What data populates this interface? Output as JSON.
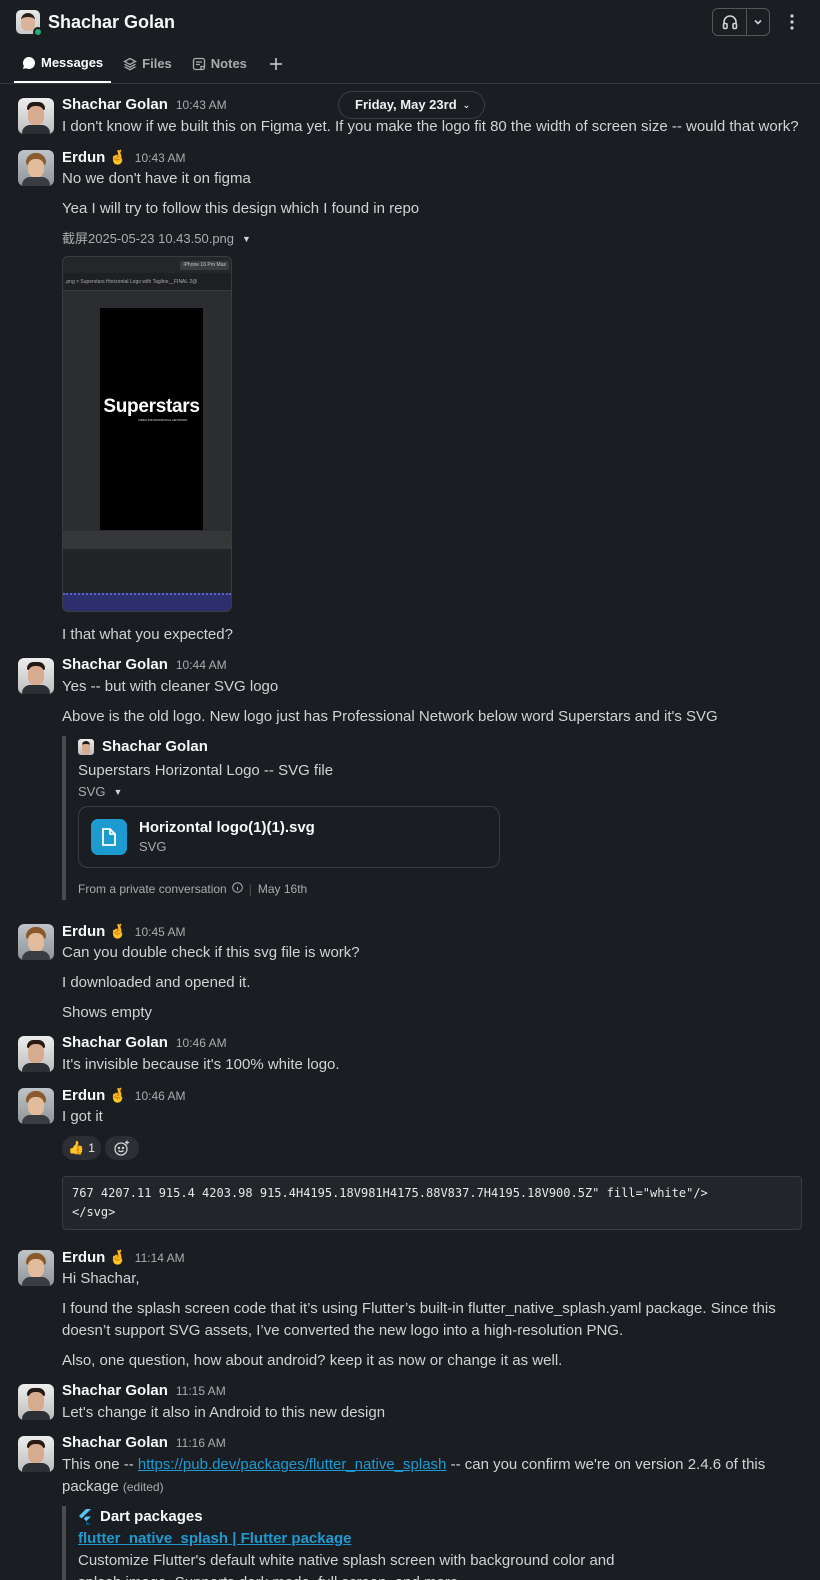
{
  "header": {
    "title": "Shachar Golan"
  },
  "tabs": [
    {
      "label": "Messages"
    },
    {
      "label": "Files"
    },
    {
      "label": "Notes"
    }
  ],
  "date_pill": "Friday, May 23rd",
  "messages": [
    {
      "author": "Shachar Golan",
      "time": "10:43 AM",
      "texts": [
        "I don't know if we built this on Figma yet. If you make the logo fit 80 the width of screen size -- would that work?"
      ]
    },
    {
      "author": "Erdun",
      "emoji": "🤞",
      "time": "10:43 AM",
      "texts": [
        "No we don't have it on figma",
        "Yea I will try to follow this design which I found in repo"
      ],
      "attachment": {
        "filename": "截屏2025-05-23 10.43.50.png",
        "preview_device": "iPhone 16 Pro Max",
        "preview_tab": ".png  ×   Superstars Horizontal Logo with Tagline__FINAL 2@",
        "preview_logo": "Superstars",
        "preview_tagline": "VIDEO PROFESSIONAL NETWORK"
      },
      "after_text": "I that what you expected?"
    },
    {
      "author": "Shachar Golan",
      "time": "10:44 AM",
      "texts": [
        "Yes -- but with cleaner SVG logo",
        "Above is the old logo. New logo just has Professional Network below word Superstars and it's SVG"
      ],
      "quote": {
        "author": "Shachar Golan",
        "text": "Superstars Horizontal Logo -- SVG file",
        "kind": "SVG",
        "file_name": "Horizontal logo(1)(1).svg",
        "file_type": "SVG",
        "footer_source": "From a private conversation",
        "footer_date": "May 16th"
      }
    },
    {
      "author": "Erdun",
      "emoji": "🤞",
      "time": "10:45 AM",
      "texts": [
        "Can you double check if this svg file is work?",
        "I downloaded and opened it.",
        "Shows empty"
      ]
    },
    {
      "author": "Shachar Golan",
      "time": "10:46 AM",
      "texts": [
        "It's invisible because it's 100% white logo."
      ]
    },
    {
      "author": "Erdun",
      "emoji": "🤞",
      "time": "10:46 AM",
      "texts": [
        "I got it"
      ],
      "reaction": {
        "emoji": "👍",
        "count": "1"
      }
    },
    {
      "code": "767 4207.11 915.4 4203.98 915.4H4195.18V981H4175.88V837.7H4195.18V900.5Z\" fill=\"white\"/>\n</svg>"
    },
    {
      "author": "Erdun",
      "emoji": "🤞",
      "time": "11:14 AM",
      "texts": [
        "Hi Shachar,",
        "I found the splash screen code that it’s using Flutter’s built-in flutter_native_splash.yaml package. Since this doesn’t support SVG assets, I’ve converted the new logo into a high-resolution PNG.",
        "Also, one question, how about android? keep it as now or change it as well."
      ]
    },
    {
      "author": "Shachar Golan",
      "time": "11:15 AM",
      "texts": [
        "Let's change it also in Android to this new design"
      ]
    },
    {
      "author": "Shachar Golan",
      "time": "11:16 AM",
      "text_before_link": "This one -- ",
      "link": "https://pub.dev/packages/flutter_native_splash",
      "text_after_link": " -- can you confirm we're on version 2.4.6 of this package",
      "edited": "(edited)",
      "unfurl": {
        "source": "Dart packages",
        "title": "flutter_native_splash | Flutter package",
        "description": "Customize Flutter's default white native splash screen with background color and splash image. Supports dark mode, full screen, and more."
      }
    }
  ],
  "icons": [
    "headphones-icon",
    "chevron-down-icon",
    "more-vertical-icon",
    "messages-icon",
    "files-icon",
    "notes-icon",
    "plus-icon",
    "file-doc-icon",
    "info-icon",
    "add-reaction-icon",
    "flutter-icon"
  ],
  "colors": {
    "background": "#1a1d21",
    "link": "#1d9bd1",
    "presence": "#2bac76"
  }
}
